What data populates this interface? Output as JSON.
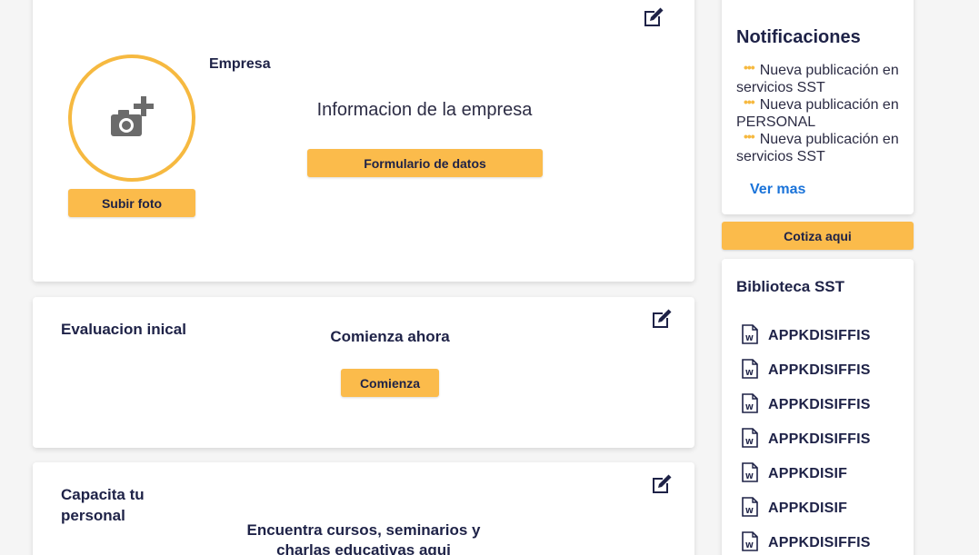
{
  "company_card": {
    "company_label": "Empresa",
    "info_title": "Informacion de la empresa",
    "form_button": "Formulario de datos",
    "upload_button": "Subir foto"
  },
  "eval_card": {
    "heading": "Evaluacion inical",
    "subheading": "Comienza ahora",
    "button": "Comienza"
  },
  "train_card": {
    "heading_line1": "Capacita tu",
    "heading_line2": "personal",
    "subheading_line1": "Encuentra cursos, seminarios y",
    "subheading_line2": "charlas educativas aqui"
  },
  "notifications": {
    "title": "Notificaciones",
    "items": [
      {
        "dots": "•••",
        "text": "Nueva publicación en servicios SST"
      },
      {
        "dots": "•••",
        "text": "Nueva publicación en PERSONAL"
      },
      {
        "dots": "•••",
        "text": "Nueva publicación en servicios SST"
      }
    ],
    "more_link": "Ver mas"
  },
  "quote_button": "Cotiza aqui",
  "library": {
    "title": "Biblioteca SST",
    "documents": [
      {
        "name": "APPKDISIFFIS",
        "icon": "word-document-icon"
      },
      {
        "name": "APPKDISIFFIS",
        "icon": "word-document-icon"
      },
      {
        "name": "APPKDISIFFIS",
        "icon": "word-document-icon"
      },
      {
        "name": "APPKDISIFFIS",
        "icon": "word-document-icon"
      },
      {
        "name": "APPKDISIF",
        "icon": "word-document-icon"
      },
      {
        "name": "APPKDISIF",
        "icon": "word-document-icon"
      },
      {
        "name": "APPKDISIFFIS",
        "icon": "word-document-icon"
      }
    ]
  },
  "colors": {
    "accent_yellow": "#fbbb4b",
    "dark_text": "#1e2247",
    "link_blue": "#1a73d9",
    "background": "#f5f5f5"
  },
  "icons": {
    "edit": "edit-icon",
    "camera": "add-photo-camera-icon",
    "document": "word-document-icon"
  }
}
